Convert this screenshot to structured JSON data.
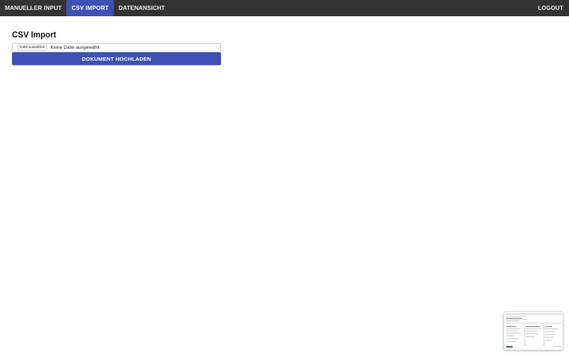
{
  "nav": {
    "items": [
      {
        "label": "MANUELLER INPUT",
        "active": false
      },
      {
        "label": "CSV IMPORT",
        "active": true
      },
      {
        "label": "DATENANSICHT",
        "active": false
      }
    ],
    "logout_label": "LOGOUT"
  },
  "main": {
    "title": "CSV Import",
    "file_input": {
      "button_label": "Datei auswählen",
      "status": "Keine Datei ausgewählt"
    },
    "upload_label": "DOKUMENT HOCHLADEN"
  },
  "colors": {
    "navbar": "#333333",
    "accent": "#3f51b5",
    "background": "#ffffff"
  }
}
